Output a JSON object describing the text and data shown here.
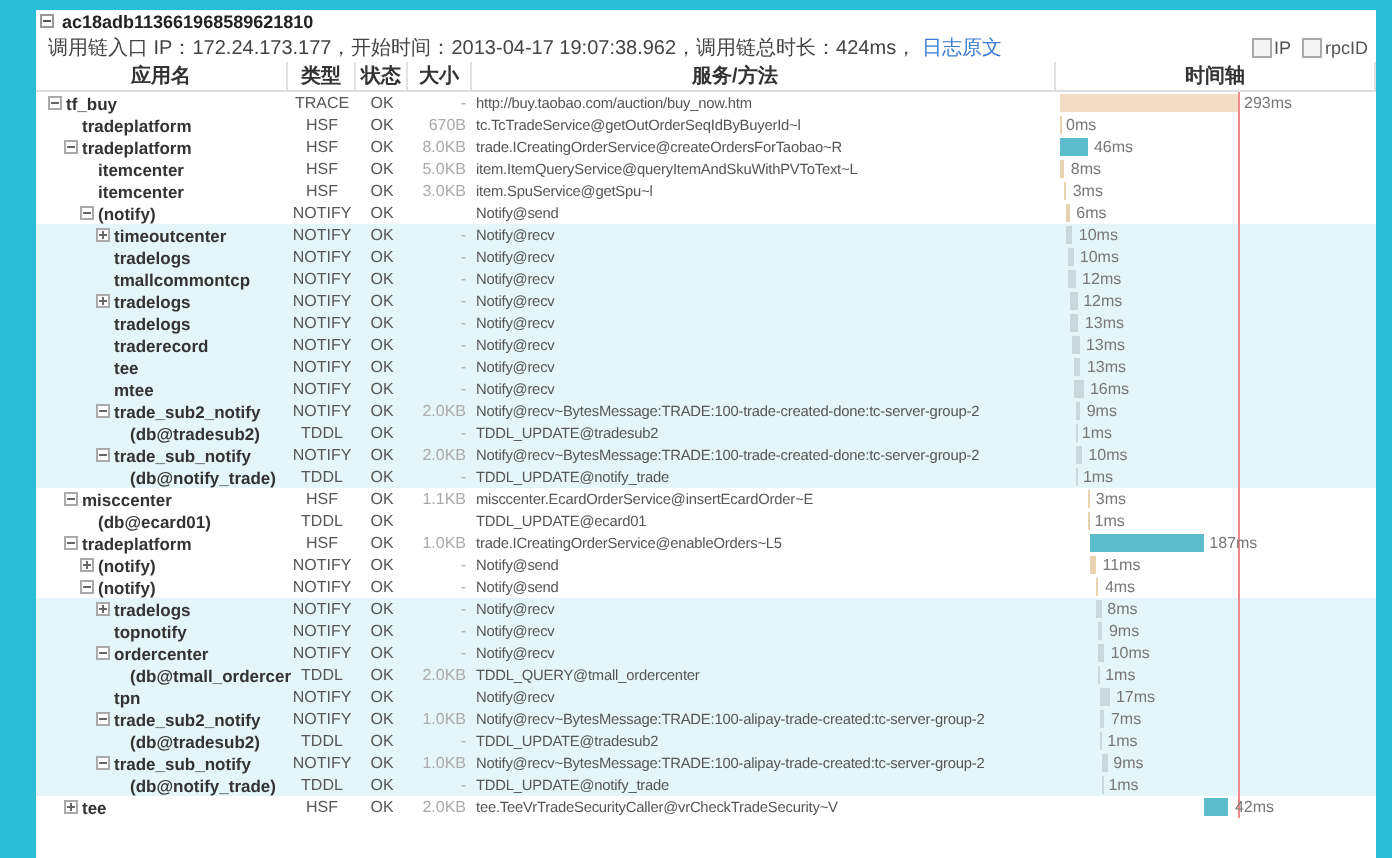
{
  "trace": {
    "id": "ac18adb113661968589621810",
    "expanded": true,
    "info": "调用链入口 IP：172.24.173.177，开始时间：2013-04-17 19:07:38.962，调用链总时长：424ms，",
    "log_link": "日志原文"
  },
  "options": [
    {
      "label": "IP",
      "checked": false
    },
    {
      "label": "rpcID",
      "checked": false
    }
  ],
  "columns": [
    "应用名",
    "类型",
    "状态",
    "大小",
    "服务/方法",
    "时间轴"
  ],
  "rows": [
    {
      "name": "tf_buy",
      "type": "TRACE",
      "status": "OK",
      "size": "-",
      "method": "http://buy.taobao.com/auction/buy_now.htm",
      "time": "293ms",
      "color": "#f2dcc4",
      "highlighted": false,
      "expanded": true,
      "children": [
        {
          "name": "tradeplatform",
          "type": "HSF",
          "status": "OK",
          "size": "670B",
          "method": "tc.TcTradeService@getOutOrderSeqIdByBuyerId~l",
          "time": "0ms",
          "color": "#e8d2b0",
          "highlighted": false
        },
        {
          "name": "tradeplatform",
          "type": "HSF",
          "status": "OK",
          "size": "8.0KB",
          "method": "trade.ICreatingOrderService@createOrdersForTaobao~R",
          "time": "46ms",
          "color": "#5cbccb",
          "highlighted": false,
          "expanded": true,
          "children": [
            {
              "name": "itemcenter",
              "type": "HSF",
              "status": "OK",
              "size": "5.0KB",
              "method": "item.ItemQueryService@queryItemAndSkuWithPVToText~L",
              "time": "8ms",
              "color": "#e8d2b0",
              "highlighted": false
            },
            {
              "name": "itemcenter",
              "type": "HSF",
              "status": "OK",
              "size": "3.0KB",
              "method": "item.SpuService@getSpu~l",
              "time": "3ms",
              "color": "#e8d2b0",
              "highlighted": false
            },
            {
              "name": "(notify)",
              "type": "NOTIFY",
              "status": "OK",
              "method": "Notify@send",
              "time": "6ms",
              "color": "#e8d2b0",
              "highlighted": false,
              "expanded": true,
              "children": [
                {
                  "name": "timeoutcenter",
                  "type": "NOTIFY",
                  "status": "OK",
                  "size": "-",
                  "method": "Notify@recv",
                  "time": "10ms",
                  "color": "#c8d8dc",
                  "highlighted": true,
                  "expanded": false
                },
                {
                  "name": "tradelogs",
                  "type": "NOTIFY",
                  "status": "OK",
                  "size": "-",
                  "method": "Notify@recv",
                  "time": "10ms",
                  "color": "#c8d8dc",
                  "highlighted": true
                },
                {
                  "name": "tmallcommontcp",
                  "type": "NOTIFY",
                  "status": "OK",
                  "size": "-",
                  "method": "Notify@recv",
                  "time": "12ms",
                  "color": "#c8d8dc",
                  "highlighted": true
                },
                {
                  "name": "tradelogs",
                  "type": "NOTIFY",
                  "status": "OK",
                  "size": "-",
                  "method": "Notify@recv",
                  "time": "12ms",
                  "color": "#c8d8dc",
                  "highlighted": true,
                  "expanded": false
                },
                {
                  "name": "tradelogs",
                  "type": "NOTIFY",
                  "status": "OK",
                  "size": "-",
                  "method": "Notify@recv",
                  "time": "13ms",
                  "color": "#c8d8dc",
                  "highlighted": true
                },
                {
                  "name": "traderecord",
                  "type": "NOTIFY",
                  "status": "OK",
                  "size": "-",
                  "method": "Notify@recv",
                  "time": "13ms",
                  "color": "#c8d8dc",
                  "highlighted": true
                },
                {
                  "name": "tee",
                  "type": "NOTIFY",
                  "status": "OK",
                  "size": "-",
                  "method": "Notify@recv",
                  "time": "13ms",
                  "color": "#c8d8dc",
                  "highlighted": true
                },
                {
                  "name": "mtee",
                  "type": "NOTIFY",
                  "status": "OK",
                  "size": "-",
                  "method": "Notify@recv",
                  "time": "16ms",
                  "color": "#c8d8dc",
                  "highlighted": true
                },
                {
                  "name": "trade_sub2_notify",
                  "type": "NOTIFY",
                  "status": "OK",
                  "size": "2.0KB",
                  "method": "Notify@recv~BytesMessage:TRADE:100-trade-created-done:tc-server-group-2",
                  "time": "9ms",
                  "color": "#c8d8dc",
                  "highlighted": true,
                  "expanded": true,
                  "children": [
                    {
                      "name": "(db@tradesub2)",
                      "type": "TDDL",
                      "status": "OK",
                      "size": "-",
                      "method": "TDDL_UPDATE@tradesub2",
                      "time": "1ms",
                      "color": "#c8d8dc",
                      "highlighted": true
                    }
                  ]
                },
                {
                  "name": "trade_sub_notify",
                  "type": "NOTIFY",
                  "status": "OK",
                  "size": "2.0KB",
                  "method": "Notify@recv~BytesMessage:TRADE:100-trade-created-done:tc-server-group-2",
                  "time": "10ms",
                  "color": "#c8d8dc",
                  "highlighted": true,
                  "expanded": true,
                  "children": [
                    {
                      "name": "(db@notify_trade)",
                      "type": "TDDL",
                      "status": "OK",
                      "size": "-",
                      "method": "TDDL_UPDATE@notify_trade",
                      "time": "1ms",
                      "color": "#c8d8dc",
                      "highlighted": true
                    }
                  ]
                }
              ]
            }
          ]
        },
        {
          "name": "misccenter",
          "type": "HSF",
          "status": "OK",
          "size": "1.1KB",
          "method": "misccenter.EcardOrderService@insertEcardOrder~E",
          "time": "3ms",
          "color": "#e8d2b0",
          "highlighted": false,
          "expanded": true,
          "children": [
            {
              "name": "(db@ecard01)",
              "type": "TDDL",
              "status": "OK",
              "method": "TDDL_UPDATE@ecard01",
              "time": "1ms",
              "color": "#e8d2b0",
              "highlighted": false
            }
          ]
        },
        {
          "name": "tradeplatform",
          "type": "HSF",
          "status": "OK",
          "size": "1.0KB",
          "method": "trade.ICreatingOrderService@enableOrders~L5",
          "time": "187ms",
          "color": "#5cbccb",
          "highlighted": false,
          "expanded": true,
          "children": [
            {
              "name": "(notify)",
              "type": "NOTIFY",
              "status": "OK",
              "size": "-",
              "method": "Notify@send",
              "time": "11ms",
              "color": "#e8d2b0",
              "highlighted": false,
              "expanded": false
            },
            {
              "name": "(notify)",
              "type": "NOTIFY",
              "status": "OK",
              "size": "-",
              "method": "Notify@send",
              "time": "4ms",
              "color": "#e8d2b0",
              "highlighted": false,
              "expanded": true,
              "children": [
                {
                  "name": "tradelogs",
                  "type": "NOTIFY",
                  "status": "OK",
                  "size": "-",
                  "method": "Notify@recv",
                  "time": "8ms",
                  "color": "#c8d8dc",
                  "highlighted": true,
                  "expanded": false
                },
                {
                  "name": "topnotify",
                  "type": "NOTIFY",
                  "status": "OK",
                  "size": "-",
                  "method": "Notify@recv",
                  "time": "9ms",
                  "color": "#c8d8dc",
                  "highlighted": true
                },
                {
                  "name": "ordercenter",
                  "type": "NOTIFY",
                  "status": "OK",
                  "size": "-",
                  "method": "Notify@recv",
                  "time": "10ms",
                  "color": "#c8d8dc",
                  "highlighted": true,
                  "expanded": true,
                  "children": [
                    {
                      "name": "(db@tmall_ordercer",
                      "type": "TDDL",
                      "status": "OK",
                      "size": "2.0KB",
                      "method": "TDDL_QUERY@tmall_ordercenter",
                      "time": "1ms",
                      "color": "#c8d8dc",
                      "highlighted": true
                    }
                  ]
                },
                {
                  "name": "tpn",
                  "type": "NOTIFY",
                  "status": "OK",
                  "method": "Notify@recv",
                  "time": "17ms",
                  "color": "#c8d8dc",
                  "highlighted": true
                },
                {
                  "name": "trade_sub2_notify",
                  "type": "NOTIFY",
                  "status": "OK",
                  "size": "1.0KB",
                  "method": "Notify@recv~BytesMessage:TRADE:100-alipay-trade-created:tc-server-group-2",
                  "time": "7ms",
                  "color": "#c8d8dc",
                  "highlighted": true,
                  "expanded": true,
                  "children": [
                    {
                      "name": "(db@tradesub2)",
                      "type": "TDDL",
                      "status": "OK",
                      "size": "-",
                      "method": "TDDL_UPDATE@tradesub2",
                      "time": "1ms",
                      "color": "#c8d8dc",
                      "highlighted": true
                    }
                  ]
                },
                {
                  "name": "trade_sub_notify",
                  "type": "NOTIFY",
                  "status": "OK",
                  "size": "1.0KB",
                  "method": "Notify@recv~BytesMessage:TRADE:100-alipay-trade-created:tc-server-group-2",
                  "time": "9ms",
                  "color": "#c8d8dc",
                  "highlighted": true,
                  "expanded": true,
                  "children": [
                    {
                      "name": "(db@notify_trade)",
                      "type": "TDDL",
                      "status": "OK",
                      "size": "-",
                      "method": "TDDL_UPDATE@notify_trade",
                      "time": "1ms",
                      "color": "#c8d8dc",
                      "highlighted": true
                    }
                  ]
                }
              ]
            }
          ]
        },
        {
          "name": "tee",
          "type": "HSF",
          "status": "OK",
          "size": "2.0KB",
          "method": "tee.TeeVrTradeSecurityCaller@vrCheckTradeSecurity~V",
          "time": "42ms",
          "color": "#5cbccb",
          "highlighted": false,
          "expanded": false
        }
      ]
    }
  ]
}
